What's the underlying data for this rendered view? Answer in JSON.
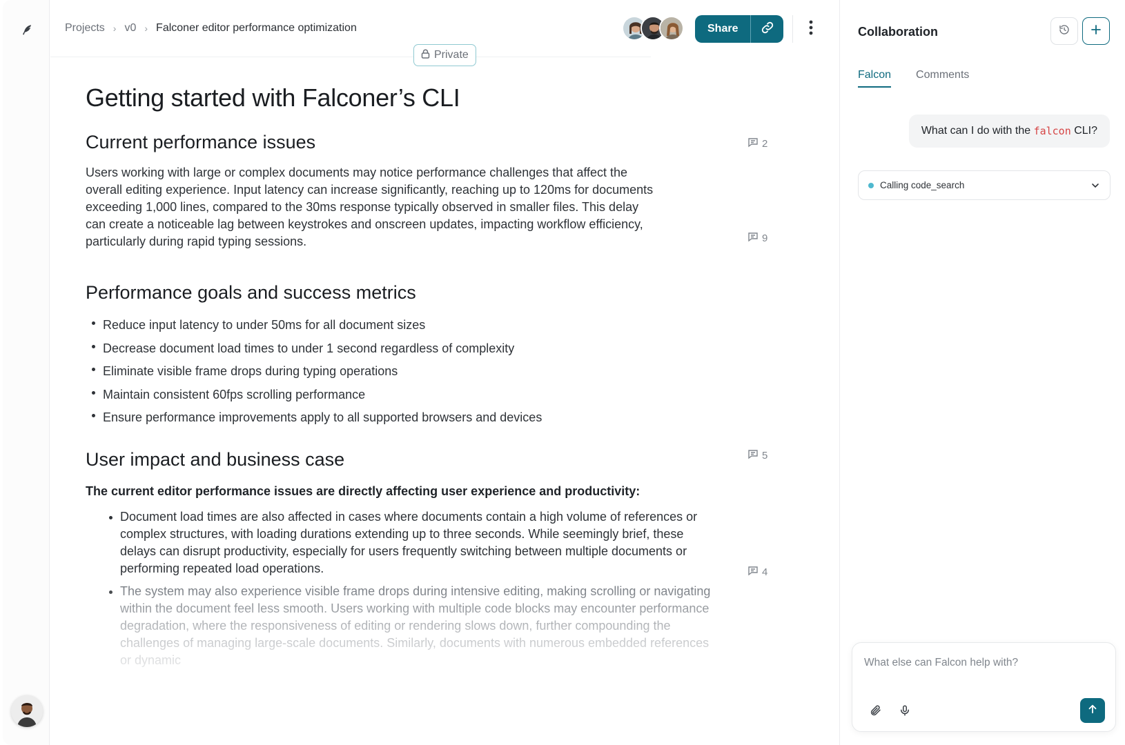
{
  "breadcrumb": {
    "items": [
      "Projects",
      "v0",
      "Falconer editor performance optimization"
    ]
  },
  "visibility": {
    "label": "Private"
  },
  "header": {
    "share_label": "Share"
  },
  "document": {
    "title": "Getting started with Falconer’s CLI",
    "sections": [
      {
        "heading": "Current performance issues",
        "comment_count": "2",
        "paragraph": "Users working with large or complex documents may notice performance challenges that affect the overall editing experience. Input latency can increase significantly, reaching up to 120ms for documents exceeding 1,000 lines, compared to the 30ms response typically observed in smaller files. This delay can create a noticeable lag between keystrokes and onscreen updates, impacting workflow efficiency, particularly during rapid typing sessions.",
        "paragraph_comment_count": "9"
      },
      {
        "heading": "Performance goals and success metrics",
        "bullets": [
          "Reduce input latency to under 50ms for all document sizes",
          "Decrease document load times to under 1 second regardless of complexity",
          "Eliminate visible frame drops during typing operations",
          "Maintain consistent 60fps scrolling performance",
          "Ensure performance improvements apply to all supported browsers and devices"
        ]
      },
      {
        "heading": "User impact and business case",
        "comment_count": "5",
        "lead": "The current editor performance issues are directly affecting user experience and productivity:",
        "bullets": [
          "Document load times are also affected in cases where documents contain a high volume of references or complex structures, with loading durations extending up to three seconds. While seemingly brief, these delays can disrupt productivity, especially for users frequently switching between multiple documents or performing repeated load operations.",
          "The system may also experience visible frame drops during intensive editing, making scrolling or navigating within the document feel less smooth. Users working with multiple code blocks may encounter performance degradation, where the responsiveness of editing or rendering slows down, further compounding the challenges of managing large-scale documents. Similarly, documents with numerous embedded references or dynamic"
        ],
        "bullet_comment_count": "4"
      }
    ]
  },
  "panel": {
    "title": "Collaboration",
    "tabs": [
      "Falcon",
      "Comments"
    ],
    "user_message": {
      "before": "What can I do with the ",
      "code": "falcon",
      "after": " CLI?"
    },
    "tool_call": "Calling code_search",
    "composer": {
      "placeholder": "What else can Falcon help with?"
    }
  },
  "icons": {
    "rail_logo": "feather-icon",
    "history": "history-icon",
    "new_chat": "plus-icon",
    "lock": "lock-icon",
    "link": "link-icon",
    "more": "kebab-menu-icon",
    "comment": "comment-icon",
    "attach": "paperclip-icon",
    "mic": "microphone-icon",
    "send": "arrow-up-icon"
  },
  "colors": {
    "accent": "#0e6a7f",
    "code": "#d64545",
    "status_dot": "#4fb8cf"
  }
}
